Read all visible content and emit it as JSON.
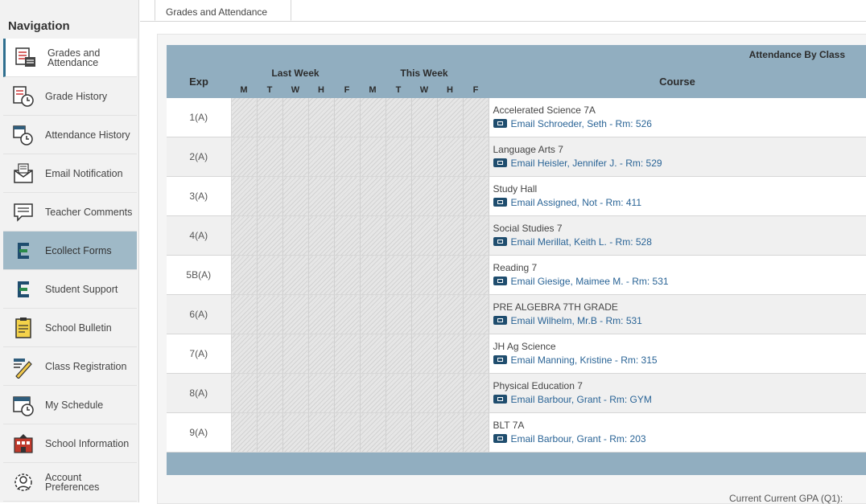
{
  "sidebar": {
    "title": "Navigation",
    "items": [
      {
        "label": "Grades and Attendance",
        "icon": "grades-icon"
      },
      {
        "label": "Grade History",
        "icon": "grade-history-icon"
      },
      {
        "label": "Attendance History",
        "icon": "attendance-history-icon"
      },
      {
        "label": "Email Notification",
        "icon": "email-icon"
      },
      {
        "label": "Teacher Comments",
        "icon": "comments-icon"
      },
      {
        "label": "Ecollect Forms",
        "icon": "ecollect-icon"
      },
      {
        "label": "Student Support",
        "icon": "support-icon"
      },
      {
        "label": "School Bulletin",
        "icon": "bulletin-icon"
      },
      {
        "label": "Class Registration",
        "icon": "registration-icon"
      },
      {
        "label": "My Schedule",
        "icon": "schedule-icon"
      },
      {
        "label": "School Information",
        "icon": "school-icon"
      },
      {
        "label": "Account Preferences",
        "icon": "account-icon"
      }
    ]
  },
  "tab": {
    "label": "Grades and Attendance"
  },
  "table": {
    "title": "Attendance By Class",
    "exp_header": "Exp",
    "last_week": "Last Week",
    "this_week": "This Week",
    "course_header": "Course",
    "days": [
      "M",
      "T",
      "W",
      "H",
      "F"
    ],
    "rows": [
      {
        "exp": "1(A)",
        "course": "Accelerated Science 7A",
        "email": "Email Schroeder, Seth - Rm: 526"
      },
      {
        "exp": "2(A)",
        "course": "Language Arts 7",
        "email": "Email Heisler, Jennifer J. - Rm: 529"
      },
      {
        "exp": "3(A)",
        "course": "Study Hall",
        "email": "Email Assigned, Not - Rm: 411"
      },
      {
        "exp": "4(A)",
        "course": "Social Studies 7",
        "email": "Email Merillat, Keith L. - Rm: 528"
      },
      {
        "exp": "5B(A)",
        "course": "Reading 7",
        "email": "Email Giesige, Maimee M. - Rm: 531"
      },
      {
        "exp": "6(A)",
        "course": "PRE ALGEBRA 7TH GRADE",
        "email": "Email Wilhelm, Mr.B - Rm: 531"
      },
      {
        "exp": "7(A)",
        "course": "JH Ag Science",
        "email": "Email Manning, Kristine - Rm: 315"
      },
      {
        "exp": "8(A)",
        "course": "Physical Education 7",
        "email": "Email Barbour, Grant - Rm: GYM"
      },
      {
        "exp": "9(A)",
        "course": "BLT 7A",
        "email": "Email Barbour, Grant - Rm: 203"
      }
    ]
  },
  "gpa_label": "Current Current GPA (Q1):",
  "colors": {
    "header": "#91aec0",
    "link": "#2a6496",
    "highlight": "#9fb9c7"
  }
}
